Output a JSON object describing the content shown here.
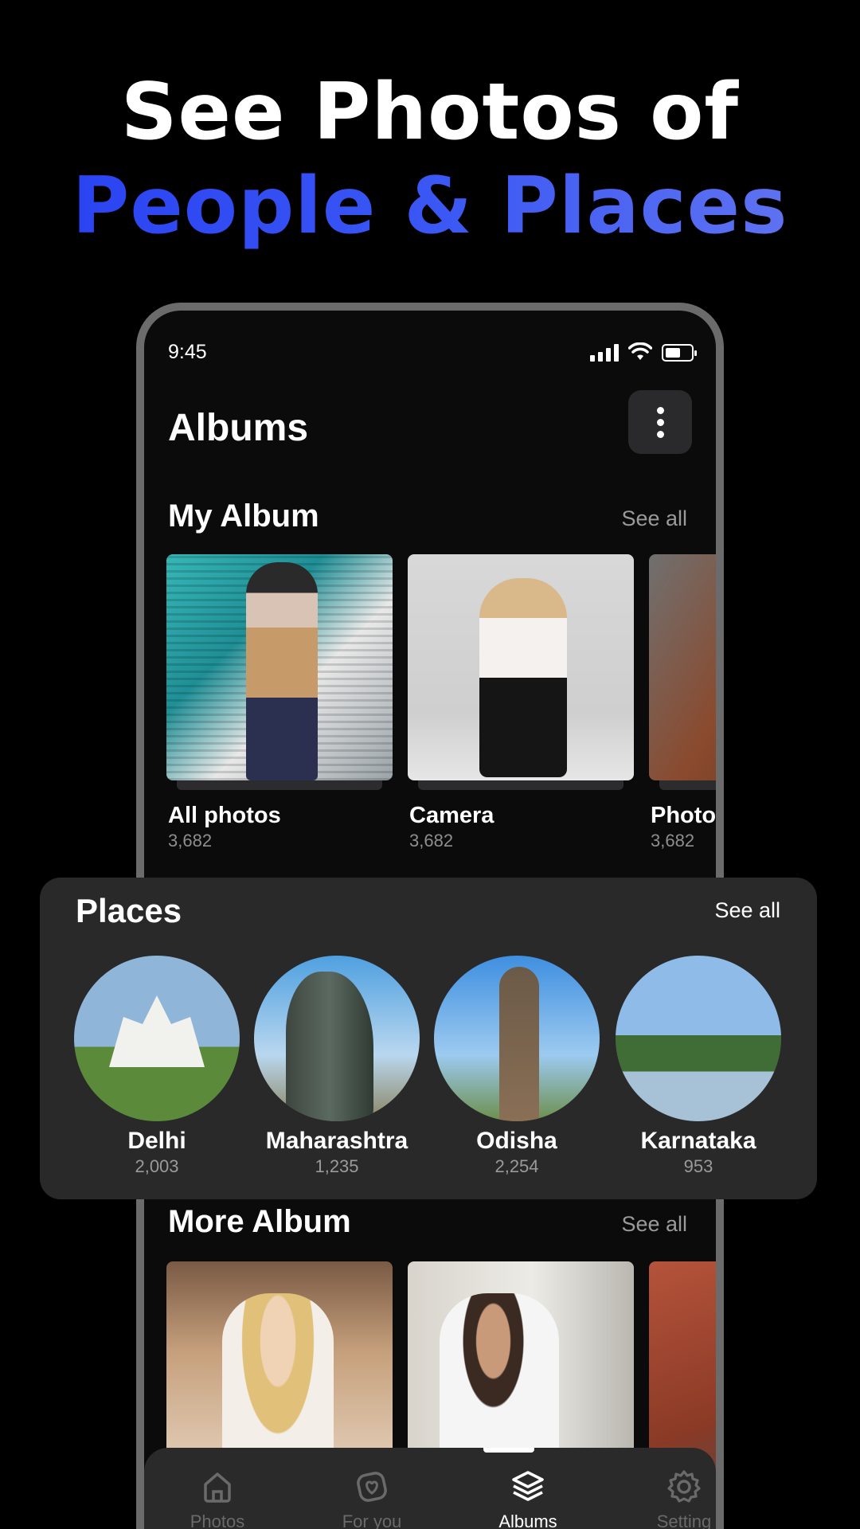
{
  "headline": {
    "line1": "See Photos of",
    "line2": "People & Places"
  },
  "status_bar": {
    "time": "9:45"
  },
  "header": {
    "title": "Albums"
  },
  "my_album": {
    "title": "My Album",
    "see_all": "See all",
    "items": [
      {
        "name": "All photos",
        "count": "3,682"
      },
      {
        "name": "Camera",
        "count": "3,682"
      },
      {
        "name": "Photo",
        "count": "3,682"
      }
    ]
  },
  "places": {
    "title": "Places",
    "see_all": "See all",
    "items": [
      {
        "name": "Delhi",
        "count": "2,003"
      },
      {
        "name": "Maharashtra",
        "count": "1,235"
      },
      {
        "name": "Odisha",
        "count": "2,254"
      },
      {
        "name": "Karnataka",
        "count": "953"
      }
    ]
  },
  "more_album": {
    "title": "More Album",
    "see_all": "See all"
  },
  "bottom_nav": {
    "items": [
      {
        "label": "Photos",
        "icon": "home-icon"
      },
      {
        "label": "For you",
        "icon": "for-you-icon"
      },
      {
        "label": "Albums",
        "icon": "albums-icon"
      },
      {
        "label": "Setting",
        "icon": "gear-icon"
      }
    ],
    "active": "Albums"
  },
  "colors": {
    "background": "#000000",
    "accent_start": "#2740f2",
    "accent_end": "#6577f0",
    "card": "#29292a"
  }
}
